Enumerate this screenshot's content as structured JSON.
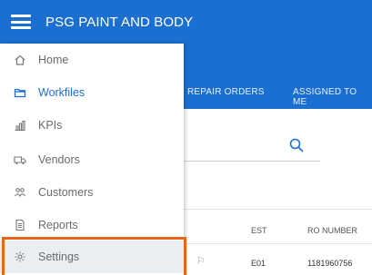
{
  "app": {
    "title": "PSG PAINT AND BODY"
  },
  "tabs": [
    {
      "label": "REPAIR ORDERS"
    },
    {
      "label": "ASSIGNED TO ME"
    }
  ],
  "sidebar": {
    "items": [
      {
        "label": "Home",
        "icon": "home-icon"
      },
      {
        "label": "Workfiles",
        "icon": "folder-icon",
        "active": true
      },
      {
        "label": "KPIs",
        "icon": "bar-chart-icon"
      },
      {
        "label": "Vendors",
        "icon": "truck-icon"
      },
      {
        "label": "Customers",
        "icon": "users-icon"
      },
      {
        "label": "Reports",
        "icon": "document-icon"
      },
      {
        "label": "Settings",
        "icon": "gear-icon"
      }
    ]
  },
  "table": {
    "headers": {
      "est": "EST",
      "ro_number": "RO NUMBER"
    },
    "rows": [
      {
        "est": "E01",
        "ro_number": "1181960756"
      }
    ]
  },
  "colors": {
    "primary": "#1b6fd1",
    "highlight": "#e4671b"
  }
}
